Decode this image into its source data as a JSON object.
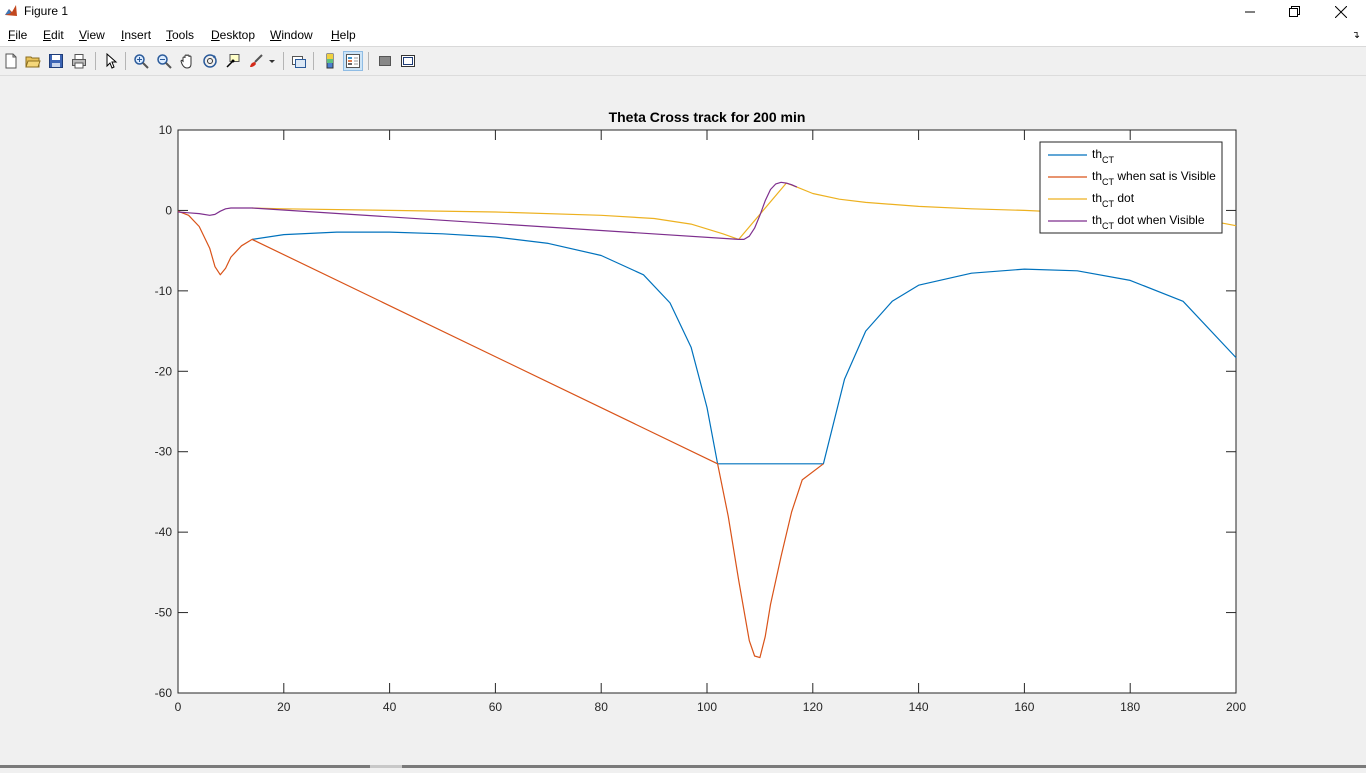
{
  "window": {
    "title": "Figure 1",
    "controls": [
      "minimize-icon",
      "restore-icon",
      "close-icon"
    ]
  },
  "menu": [
    {
      "key": "F",
      "rest": "ile"
    },
    {
      "key": "E",
      "rest": "dit"
    },
    {
      "key": "V",
      "rest": "iew"
    },
    {
      "key": "I",
      "rest": "nsert"
    },
    {
      "key": "T",
      "rest": "ools"
    },
    {
      "key": "D",
      "rest": "esktop"
    },
    {
      "key": "W",
      "rest": "indow"
    },
    {
      "key": "H",
      "rest": "elp"
    }
  ],
  "toolbar": {
    "buttons": [
      "new-figure-icon",
      "open-icon",
      "save-icon",
      "print-icon",
      "pointer-icon",
      "zoom-in-icon",
      "zoom-out-icon",
      "pan-icon",
      "rotate-3d-icon",
      "data-cursor-icon",
      "brush-icon",
      "link-plot-icon",
      "colorbar-icon",
      "legend-icon",
      "hide-plot-tools-icon",
      "show-plot-tools-icon"
    ],
    "active": "legend-icon"
  },
  "chart_data": {
    "type": "line",
    "title": "Theta Cross track for 200 min",
    "xlabel": "",
    "ylabel": "",
    "xlim": [
      0,
      200
    ],
    "ylim": [
      -60,
      10
    ],
    "xticks": [
      0,
      20,
      40,
      60,
      80,
      100,
      120,
      140,
      160,
      180,
      200
    ],
    "yticks": [
      10,
      0,
      -10,
      -20,
      -30,
      -40,
      -50,
      -60
    ],
    "legend_position": "top-right",
    "legend": [
      {
        "main": "th",
        "sub": "CT",
        "suffix": ""
      },
      {
        "main": "th",
        "sub": "CT",
        "suffix": " when sat is Visible"
      },
      {
        "main": "th",
        "sub": "CT",
        "suffix": " dot"
      },
      {
        "main": "th",
        "sub": "CT",
        "suffix": " dot when Visible"
      }
    ],
    "series": [
      {
        "color": "#0072bd",
        "points": [
          [
            14,
            -3.6
          ],
          [
            20,
            -3.0
          ],
          [
            30,
            -2.7
          ],
          [
            40,
            -2.7
          ],
          [
            50,
            -2.9
          ],
          [
            60,
            -3.3
          ],
          [
            70,
            -4.1
          ],
          [
            80,
            -5.6
          ],
          [
            88,
            -8.0
          ],
          [
            93,
            -11.5
          ],
          [
            97,
            -17.0
          ],
          [
            100,
            -24.5
          ],
          [
            102,
            -31.5
          ],
          [
            122,
            -31.5
          ],
          [
            126,
            -21.0
          ],
          [
            130,
            -15.0
          ],
          [
            135,
            -11.3
          ],
          [
            140,
            -9.3
          ],
          [
            150,
            -7.8
          ],
          [
            160,
            -7.3
          ],
          [
            170,
            -7.5
          ],
          [
            180,
            -8.7
          ],
          [
            190,
            -11.3
          ],
          [
            200,
            -18.3
          ]
        ]
      },
      {
        "color": "#d95319",
        "points": [
          [
            0,
            -0.1
          ],
          [
            2,
            -0.6
          ],
          [
            4,
            -2.0
          ],
          [
            6,
            -4.7
          ],
          [
            7,
            -7.0
          ],
          [
            8,
            -8.0
          ],
          [
            9,
            -7.2
          ],
          [
            10,
            -5.8
          ],
          [
            12,
            -4.4
          ],
          [
            14,
            -3.6
          ],
          [
            102,
            -31.5
          ],
          [
            104,
            -38.0
          ],
          [
            106,
            -46.0
          ],
          [
            108,
            -53.5
          ],
          [
            109,
            -55.4
          ],
          [
            110,
            -55.6
          ],
          [
            111,
            -53.0
          ],
          [
            112,
            -49.0
          ],
          [
            114,
            -43.0
          ],
          [
            116,
            -37.5
          ],
          [
            118,
            -33.5
          ],
          [
            122,
            -31.5
          ]
        ]
      },
      {
        "color": "#edb120",
        "points": [
          [
            14,
            0.3
          ],
          [
            20,
            0.2
          ],
          [
            40,
            0.0
          ],
          [
            60,
            -0.2
          ],
          [
            80,
            -0.6
          ],
          [
            90,
            -1.0
          ],
          [
            97,
            -1.7
          ],
          [
            100,
            -2.3
          ],
          [
            103,
            -2.9
          ],
          [
            106,
            -3.6
          ],
          [
            115,
            3.4
          ],
          [
            117,
            2.9
          ],
          [
            120,
            2.1
          ],
          [
            125,
            1.4
          ],
          [
            130,
            1.0
          ],
          [
            140,
            0.5
          ],
          [
            150,
            0.2
          ],
          [
            160,
            0.0
          ],
          [
            170,
            -0.3
          ],
          [
            180,
            -0.5
          ],
          [
            190,
            -1.0
          ],
          [
            196,
            -1.4
          ],
          [
            200,
            -1.9
          ]
        ]
      },
      {
        "color": "#7e2f8e",
        "points": [
          [
            0,
            -0.2
          ],
          [
            2,
            -0.3
          ],
          [
            4,
            -0.4
          ],
          [
            6,
            -0.6
          ],
          [
            7,
            -0.5
          ],
          [
            8,
            -0.1
          ],
          [
            9,
            0.2
          ],
          [
            10,
            0.3
          ],
          [
            12,
            0.3
          ],
          [
            14,
            0.3
          ],
          [
            106,
            -3.6
          ],
          [
            107,
            -3.6
          ],
          [
            108,
            -3.2
          ],
          [
            109,
            -2.2
          ],
          [
            110,
            -0.6
          ],
          [
            111,
            1.2
          ],
          [
            112,
            2.6
          ],
          [
            113,
            3.3
          ],
          [
            114,
            3.5
          ],
          [
            115,
            3.4
          ],
          [
            116,
            3.2
          ],
          [
            117,
            2.9
          ]
        ]
      }
    ]
  }
}
